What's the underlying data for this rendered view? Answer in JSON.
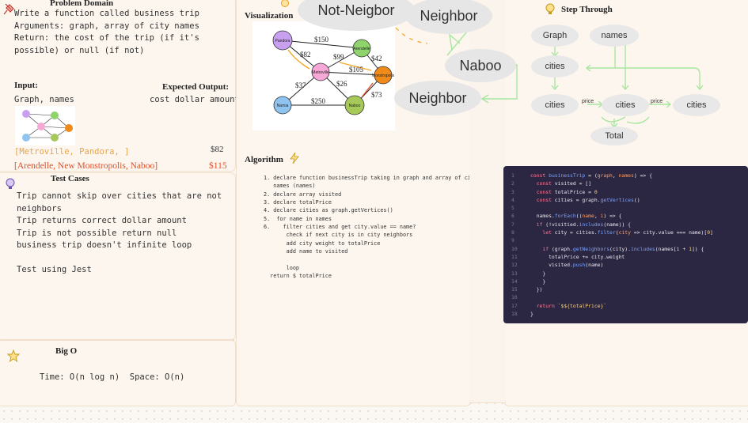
{
  "problem": {
    "title": "Problem Domain",
    "lines": [
      "Write a function called business trip",
      "Arguments: graph, array of city names",
      "Return: the cost of the trip (if it's",
      "possible) or null (if not)"
    ]
  },
  "io": {
    "input_label": "Input:",
    "input_value": "Graph, names",
    "output_label": "Expected Output:",
    "output_value": "cost dollar amount",
    "example1_input": "[Metroville, Pandora, ]",
    "example1_output": "$82",
    "example2_input": "[Arendelle, New Monstropolis, Naboo]",
    "example2_output": "$115",
    "example1_color": "#e8a44c",
    "example2_color": "#e0502b"
  },
  "tests": {
    "title": "Test Cases",
    "lines": [
      "Trip cannot skip over cities that are not",
      "neighbors",
      "Trip returns correct dollar amount",
      "Trip is not possible return null",
      "business trip doesn't infinite loop",
      "",
      "Test using Jest"
    ]
  },
  "bigo": {
    "title": "Big O",
    "text": "Time: O(n log n)  Space: O(n)"
  },
  "visualization": {
    "title": "Visualization",
    "graph_nodes": [
      "Pandora",
      "Arendelle",
      "Metroville",
      "Monstropolis",
      "Narnia",
      "Naboo"
    ],
    "graph_edges": [
      "$150",
      "$82",
      "$99",
      "$42",
      "$105",
      "$37",
      "$26",
      "$250",
      "$73"
    ],
    "bubble_not_neighbor": "Not-Neigbor",
    "bubble_neighbor_top": "Neighbor",
    "bubble_naboo": "Naboo",
    "bubble_neighbor_bottom": "Neighbor"
  },
  "algorithm": {
    "title": "Algorithm",
    "lines": [
      "1. declare function businessTrip taking in graph and array of city",
      "   names (names)",
      "2. declare array visited",
      "3. declare totalPrice",
      "4. declare cities as graph.getVertices()",
      "5.  for name in names",
      "6.    filter cities and get city.value == name?",
      "       check if next city is in city neighbors",
      "       add city weight to totalPrice",
      "       add name to visited",
      "",
      "       loop",
      "  return $ totalPrice"
    ]
  },
  "step_through": {
    "title": "Step Through",
    "graph": "Graph",
    "names": "names",
    "cities_top": "cities",
    "cities_a": "cities",
    "cities_b": "cities",
    "cities_c": "cities",
    "price_1": "price",
    "price_2": "price",
    "total": "Total"
  },
  "code": {
    "line_numbers": [
      "1",
      "2",
      "3",
      "4",
      "5",
      "6",
      "7",
      "8",
      "9",
      "10",
      "11",
      "12",
      "13",
      "14",
      "15",
      "16",
      "17",
      "18"
    ]
  },
  "colors": {
    "panel_bg": "#fdf6ee",
    "code_bg": "#2b2641",
    "accent_orange": "#f5a623",
    "green_arrow": "#a8e6a0"
  }
}
